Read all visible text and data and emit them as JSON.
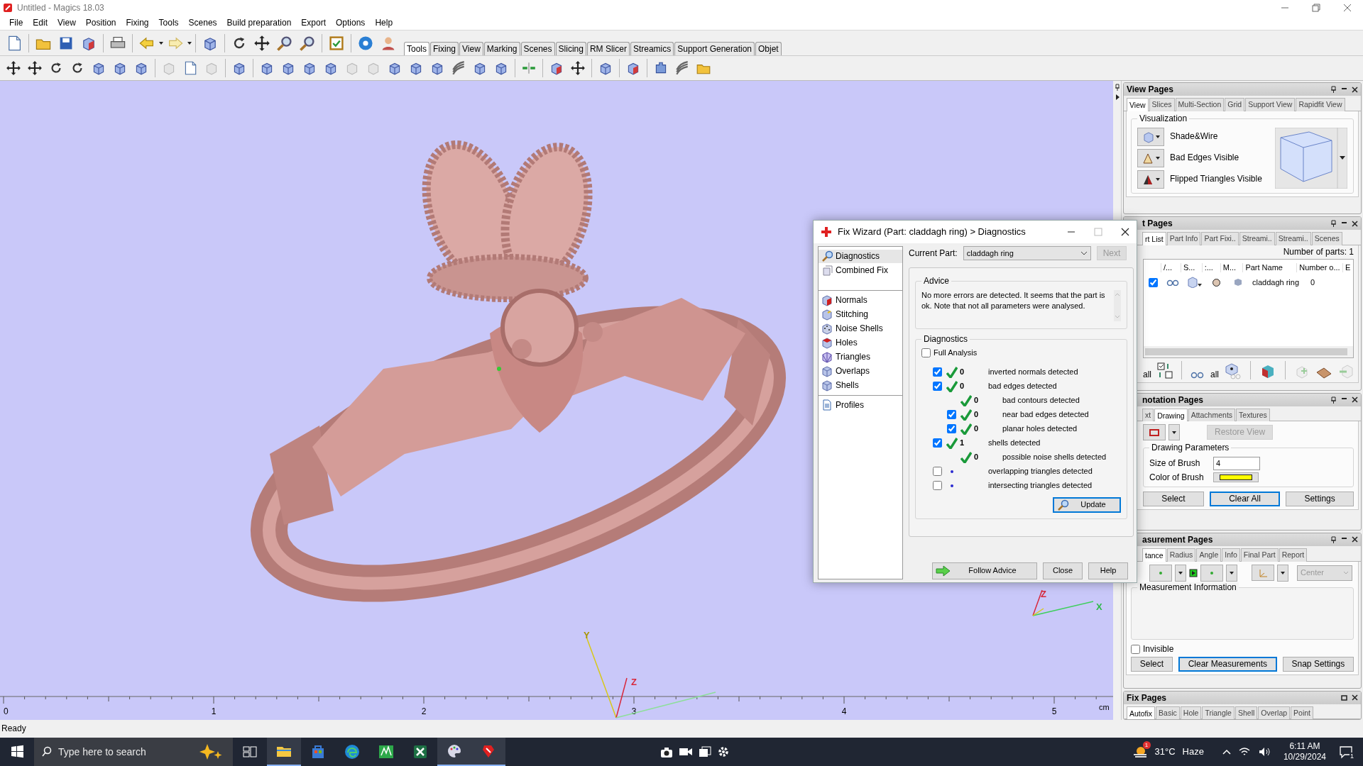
{
  "window": {
    "title": "Untitled - Magics 18.03"
  },
  "menu": [
    "File",
    "Edit",
    "View",
    "Position",
    "Fixing",
    "Tools",
    "Scenes",
    "Build preparation",
    "Export",
    "Options",
    "Help"
  ],
  "toolbar_tabs": [
    {
      "label": "Tools",
      "selected": true
    },
    {
      "label": "Fixing",
      "selected": false
    },
    {
      "label": "View",
      "selected": false
    },
    {
      "label": "Marking",
      "selected": false
    },
    {
      "label": "Scenes",
      "selected": false
    },
    {
      "label": "Slicing",
      "selected": false
    },
    {
      "label": "RM Slicer",
      "selected": false
    },
    {
      "label": "Streamics",
      "selected": false
    },
    {
      "label": "Support Generation",
      "selected": false
    },
    {
      "label": "Objet",
      "selected": false
    }
  ],
  "viewport": {
    "axis_labels": [
      {
        "text": "Z",
        "color": "#d8283c"
      },
      {
        "text": "X",
        "color": "#2fb84c"
      },
      {
        "text": "Y",
        "color": "#a89400"
      },
      {
        "text": "Z",
        "color": "#d8283c"
      }
    ],
    "ruler": {
      "labels": [
        "0",
        "1",
        "2",
        "3",
        "4",
        "5"
      ],
      "unit": "cm"
    }
  },
  "fix_wizard": {
    "title": "Fix Wizard (Part: claddagh ring) > Diagnostics",
    "nav_groups": [
      {
        "items": [
          {
            "label": "Diagnostics",
            "kind": "search",
            "selected": true
          },
          {
            "label": "Combined Fix",
            "kind": "stack",
            "selected": false
          }
        ]
      },
      {
        "items": [
          {
            "label": "Normals",
            "kind": "cube-red",
            "selected": false
          },
          {
            "label": "Stitching",
            "kind": "cube-yellow",
            "selected": false
          },
          {
            "label": "Noise Shells",
            "kind": "dice",
            "selected": false
          },
          {
            "label": "Holes",
            "kind": "cube-top",
            "selected": false
          },
          {
            "label": "Triangles",
            "kind": "mesh",
            "selected": false
          },
          {
            "label": "Overlaps",
            "kind": "cube",
            "selected": false
          },
          {
            "label": "Shells",
            "kind": "cube",
            "selected": false
          }
        ]
      },
      {
        "items": [
          {
            "label": "Profiles",
            "kind": "doc",
            "selected": false
          }
        ]
      }
    ],
    "current_part_label": "Current Part:",
    "current_part": "claddagh ring",
    "next_button": {
      "label": "Next",
      "disabled": true
    },
    "advice": {
      "title": "Advice",
      "text": "No more errors are detected. It seems that the part is ok. Note that not all parameters were analysed."
    },
    "diagnostics": {
      "title": "Diagnostics",
      "full_analysis": {
        "label": "Full Analysis",
        "checked": false
      },
      "rows": [
        {
          "checked": true,
          "passed": true,
          "count": "0",
          "label": "inverted normals detected"
        },
        {
          "checked": true,
          "passed": true,
          "count": "0",
          "label": "bad edges detected",
          "children": [
            {
              "passed": true,
              "count": "0",
              "label": "bad contours detected"
            },
            {
              "checked": true,
              "passed": true,
              "count": "0",
              "label": "near bad edges detected"
            },
            {
              "checked": true,
              "passed": true,
              "count": "0",
              "label": "planar holes detected"
            }
          ]
        },
        {
          "checked": true,
          "passed": true,
          "count": "1",
          "label": "shells detected",
          "children": [
            {
              "passed": true,
              "count": "0",
              "label": "possible noise shells detected"
            }
          ]
        },
        {
          "checked": false,
          "passed": false,
          "label": "overlapping triangles detected"
        },
        {
          "checked": false,
          "passed": false,
          "label": "intersecting triangles detected"
        }
      ]
    },
    "update_button": "Update",
    "buttons": [
      {
        "label": "Follow Advice",
        "kind": "follow"
      },
      {
        "label": "Close",
        "kind": "plain"
      },
      {
        "label": "Help",
        "kind": "plain"
      }
    ]
  },
  "view_pages": {
    "title": "View Pages",
    "tabs": [
      {
        "label": "View",
        "selected": true
      },
      {
        "label": "Slices",
        "selected": false
      },
      {
        "label": "Multi-Section",
        "selected": false
      },
      {
        "label": "Grid",
        "selected": false
      },
      {
        "label": "Support View",
        "selected": false
      },
      {
        "label": "Rapidfit View",
        "selected": false
      }
    ],
    "group": "Visualization",
    "options": [
      "Shade&Wire",
      "Bad Edges Visible",
      "Flipped Triangles Visible"
    ]
  },
  "part_pages": {
    "title": "t Pages",
    "tabs": [
      {
        "label": "rt List",
        "selected": true
      },
      {
        "label": "Part Info",
        "selected": false
      },
      {
        "label": "Part Fixi..",
        "selected": false
      },
      {
        "label": "Streami..",
        "selected": false
      },
      {
        "label": "Streami..",
        "selected": false
      },
      {
        "label": "Scenes",
        "selected": false
      }
    ],
    "count": "Number of parts: 1",
    "columns": [
      "/...",
      "S...",
      ":...",
      "M...",
      "Part Name",
      "Number o...",
      "E"
    ],
    "rows": [
      {
        "checked": true,
        "color": "#dcc5b2",
        "name": "claddagh ring",
        "number": "0"
      }
    ],
    "tool_labels": [
      "all",
      "all"
    ]
  },
  "annotation_pages": {
    "title": "notation Pages",
    "tabs": [
      {
        "label": "xt",
        "selected": false
      },
      {
        "label": "Drawing",
        "selected": true
      },
      {
        "label": "Attachments",
        "selected": false
      },
      {
        "label": "Textures",
        "selected": false
      }
    ],
    "restore_button": {
      "label": "Restore View",
      "disabled": true
    },
    "group": "Drawing Parameters",
    "size_label": "Size of Brush",
    "size_value": "4",
    "color_label": "Color of Brush",
    "brush": {
      "color": "#ffff00"
    },
    "buttons": [
      {
        "label": "Select",
        "focused": false
      },
      {
        "label": "Clear All",
        "focused": true
      },
      {
        "label": "Settings",
        "focused": false
      }
    ]
  },
  "measurement_pages": {
    "title": "asurement Pages",
    "tabs": [
      {
        "label": "tance",
        "selected": true
      },
      {
        "label": "Radius",
        "selected": false
      },
      {
        "label": "Angle",
        "selected": false
      },
      {
        "label": "Info",
        "selected": false
      },
      {
        "label": "Final Part",
        "selected": false
      },
      {
        "label": "Report",
        "selected": false
      }
    ],
    "mode": "Center",
    "group": "Measurement Information",
    "invisible": {
      "label": "Invisible",
      "checked": false
    },
    "buttons": [
      {
        "label": "Select",
        "focused": false
      },
      {
        "label": "Clear Measurements",
        "focused": true
      },
      {
        "label": "Snap Settings",
        "focused": false
      }
    ]
  },
  "fix_pages": {
    "title": "Fix Pages",
    "tabs": [
      {
        "label": "Autofix",
        "selected": true
      },
      {
        "label": "Basic",
        "selected": false
      },
      {
        "label": "Hole",
        "selected": false
      },
      {
        "label": "Triangle",
        "selected": false
      },
      {
        "label": "Shell",
        "selected": false
      },
      {
        "label": "Overlap",
        "selected": false
      },
      {
        "label": "Point",
        "selected": false
      }
    ]
  },
  "status_bar": "Ready",
  "taskbar": {
    "search_placeholder": "Type here to search",
    "weather_badge": "1",
    "temperature": "31°C",
    "weather": "Haze",
    "time": "6:11 AM",
    "date": "10/29/2024",
    "notifications": "1"
  }
}
